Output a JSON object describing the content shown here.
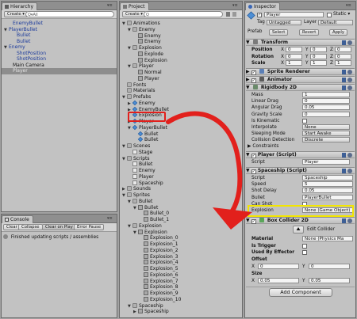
{
  "hierarchy": {
    "tab_label": "Hierarchy",
    "create_label": "Create ▾",
    "search_prefix": "Q▾All",
    "items": [
      {
        "label": "EnemyBullet",
        "indent": 1,
        "style": "blue"
      },
      {
        "label": "PlayerBullet",
        "indent": 0,
        "style": "blue",
        "arrow": "▼"
      },
      {
        "label": "Bullet",
        "indent": 2,
        "style": "blue"
      },
      {
        "label": "Bullet",
        "indent": 2,
        "style": "blue"
      },
      {
        "label": "Enemy",
        "indent": 0,
        "style": "blue",
        "arrow": "▼"
      },
      {
        "label": "ShotPosition",
        "indent": 2,
        "style": "blue"
      },
      {
        "label": "ShotPosition",
        "indent": 2,
        "style": "blue"
      },
      {
        "label": "Main Camera",
        "indent": 1,
        "style": "plain"
      },
      {
        "label": "Player",
        "indent": 1,
        "style": "selected"
      }
    ]
  },
  "project": {
    "tab_label": "Project",
    "create_label": "Create ▾",
    "tree": [
      {
        "label": "Animations",
        "indent": 0,
        "icon": "folder",
        "arrow": "▼"
      },
      {
        "label": "Enemy",
        "indent": 1,
        "icon": "folder",
        "arrow": "▼"
      },
      {
        "label": "Enemy",
        "indent": 2,
        "icon": "anim"
      },
      {
        "label": "Enemy",
        "indent": 2,
        "icon": "anim"
      },
      {
        "label": "Explosion",
        "indent": 1,
        "icon": "folder",
        "arrow": "▼"
      },
      {
        "label": "Explode",
        "indent": 2,
        "icon": "anim"
      },
      {
        "label": "Explosion",
        "indent": 2,
        "icon": "anim"
      },
      {
        "label": "Player",
        "indent": 1,
        "icon": "folder",
        "arrow": "▼"
      },
      {
        "label": "Normal",
        "indent": 2,
        "icon": "anim"
      },
      {
        "label": "Player",
        "indent": 2,
        "icon": "anim"
      },
      {
        "label": "Fonts",
        "indent": 0,
        "icon": "folder"
      },
      {
        "label": "Materials",
        "indent": 0,
        "icon": "folder"
      },
      {
        "label": "Prefabs",
        "indent": 0,
        "icon": "folder",
        "arrow": "▼"
      },
      {
        "label": "Enemy",
        "indent": 1,
        "icon": "prefab",
        "arrow": "▶"
      },
      {
        "label": "EnemyBullet",
        "indent": 1,
        "icon": "prefab",
        "arrow": "▶"
      },
      {
        "label": "Explosion",
        "indent": 1,
        "icon": "prefab"
      },
      {
        "label": "Player",
        "indent": 1,
        "icon": "prefab",
        "arrow": "▶"
      },
      {
        "label": "PlayerBullet",
        "indent": 1,
        "icon": "prefab",
        "arrow": "▼"
      },
      {
        "label": "Bullet",
        "indent": 2,
        "icon": "prefab"
      },
      {
        "label": "Bullet",
        "indent": 2,
        "icon": "prefab"
      },
      {
        "label": "Scenes",
        "indent": 0,
        "icon": "folder",
        "arrow": "▼"
      },
      {
        "label": "Stage",
        "indent": 1,
        "icon": "scene"
      },
      {
        "label": "Scripts",
        "indent": 0,
        "icon": "folder",
        "arrow": "▼"
      },
      {
        "label": "Bullet",
        "indent": 1,
        "icon": "script"
      },
      {
        "label": "Enemy",
        "indent": 1,
        "icon": "script"
      },
      {
        "label": "Player",
        "indent": 1,
        "icon": "script"
      },
      {
        "label": "Spaceship",
        "indent": 1,
        "icon": "script"
      },
      {
        "label": "Sounds",
        "indent": 0,
        "icon": "folder",
        "arrow": "▶"
      },
      {
        "label": "Sprites",
        "indent": 0,
        "icon": "folder",
        "arrow": "▼"
      },
      {
        "label": "Bullet",
        "indent": 1,
        "icon": "folder",
        "arrow": "▼"
      },
      {
        "label": "Bullet",
        "indent": 2,
        "icon": "sprite",
        "arrow": "▼"
      },
      {
        "label": "Bullet_0",
        "indent": 3,
        "icon": "sprite"
      },
      {
        "label": "Bullet_1",
        "indent": 3,
        "icon": "sprite"
      },
      {
        "label": "Explosion",
        "indent": 1,
        "icon": "folder",
        "arrow": "▼"
      },
      {
        "label": "Explosion",
        "indent": 2,
        "icon": "sprite",
        "arrow": "▼"
      },
      {
        "label": "Explosion_0",
        "indent": 3,
        "icon": "sprite"
      },
      {
        "label": "Explosion_1",
        "indent": 3,
        "icon": "sprite"
      },
      {
        "label": "Explosion_2",
        "indent": 3,
        "icon": "sprite"
      },
      {
        "label": "Explosion_3",
        "indent": 3,
        "icon": "sprite"
      },
      {
        "label": "Explosion_4",
        "indent": 3,
        "icon": "sprite"
      },
      {
        "label": "Explosion_5",
        "indent": 3,
        "icon": "sprite"
      },
      {
        "label": "Explosion_6",
        "indent": 3,
        "icon": "sprite"
      },
      {
        "label": "Explosion_7",
        "indent": 3,
        "icon": "sprite"
      },
      {
        "label": "Explosion_8",
        "indent": 3,
        "icon": "sprite"
      },
      {
        "label": "Explosion_9",
        "indent": 3,
        "icon": "sprite"
      },
      {
        "label": "Explosion_10",
        "indent": 3,
        "icon": "sprite"
      },
      {
        "label": "Spaceship",
        "indent": 1,
        "icon": "folder",
        "arrow": "▼"
      },
      {
        "label": "Spaceship",
        "indent": 2,
        "icon": "sprite",
        "arrow": "▶"
      }
    ]
  },
  "console": {
    "tab_label": "Console",
    "buttons": [
      "Clear",
      "Collapse",
      "Clear on Play",
      "Error Pause"
    ],
    "message": "Finished updating scripts / assemblies"
  },
  "inspector": {
    "tab_label": "Inspector",
    "object_name": "Player",
    "static_label": "Static ▾",
    "tag_label": "Tag",
    "tag_value": "Untagged",
    "layer_label": "Layer",
    "layer_value": "Default",
    "prefab_label": "Prefab",
    "prefab_buttons": [
      "Select",
      "Revert",
      "Apply"
    ],
    "transform": {
      "title": "Transform",
      "rows": [
        {
          "label": "Position",
          "x": "0",
          "y": "0",
          "z": "0"
        },
        {
          "label": "Rotation",
          "x": "0",
          "y": "0",
          "z": "0"
        },
        {
          "label": "Scale",
          "x": "1",
          "y": "1",
          "z": "1"
        }
      ]
    },
    "sprite_renderer_title": "Sprite Renderer",
    "animator_title": "Animator",
    "rigidbody": {
      "title": "Rigidbody 2D",
      "rows": [
        {
          "label": "Mass",
          "value": "1"
        },
        {
          "label": "Linear Drag",
          "value": "0"
        },
        {
          "label": "Angular Drag",
          "value": "0.05"
        },
        {
          "label": "Gravity Scale",
          "value": "0"
        },
        {
          "label": "Is Kinematic",
          "value": ""
        },
        {
          "label": "Interpolate",
          "value": "None"
        },
        {
          "label": "Sleeping Mode",
          "value": "Start Awake"
        },
        {
          "label": "Collision Detection",
          "value": "Discrete"
        }
      ],
      "constraints_label": "Constraints"
    },
    "player_script": {
      "title": "Player (Script)",
      "script_label": "Script",
      "script_value": "Player"
    },
    "spaceship": {
      "title": "Spaceship (Script)",
      "rows": [
        {
          "label": "Script",
          "value": "Spaceship"
        },
        {
          "label": "Speed",
          "value": "5"
        },
        {
          "label": "Shot Delay",
          "value": "0.05"
        },
        {
          "label": "Bullet",
          "value": "PlayerBullet"
        },
        {
          "label": "Can Shot",
          "value": ""
        },
        {
          "label": "Explosion",
          "value": "None (Game Object)"
        }
      ]
    },
    "box_collider": {
      "title": "Box Collider 2D",
      "edit_collider_label": "Edit Collider",
      "rows": [
        {
          "label": "Material",
          "value": "None (Physics Ma"
        },
        {
          "label": "Is Trigger",
          "value": ""
        },
        {
          "label": "Used By Effector",
          "value": ""
        },
        {
          "label": "Offset",
          "value": ""
        }
      ],
      "offset": {
        "x": "0",
        "y": "0"
      },
      "size_label": "Size",
      "size": {
        "x": "0.05",
        "y": "0.05"
      }
    },
    "add_component_label": "Add Component"
  },
  "colors": {
    "highlight_red": "#e2201c",
    "highlight_yellow": "#f2e500",
    "hierarchy_blue": "#1b3a9c"
  },
  "icons": [
    "hierarchy-icon",
    "project-icon",
    "console-icon",
    "inspector-icon",
    "search-icon",
    "gear-icon",
    "help-icon",
    "red-arrow"
  ]
}
